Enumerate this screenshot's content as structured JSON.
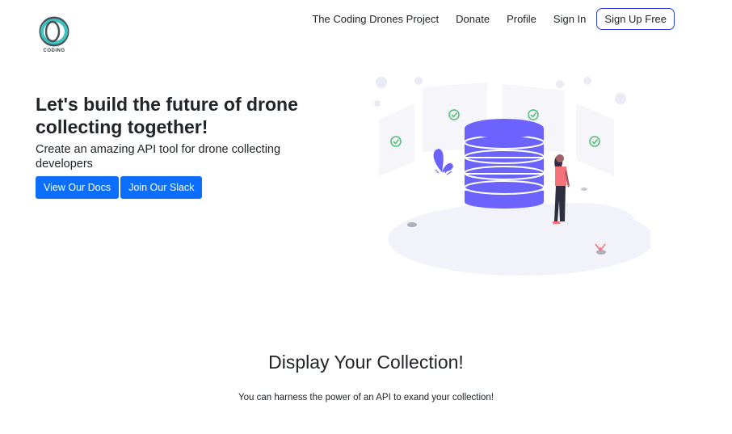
{
  "brand": {
    "logo_text": "CODING"
  },
  "nav": {
    "links": [
      "The Coding Drones Project",
      "Donate",
      "Profile",
      "Sign In"
    ],
    "signup_label": "Sign Up Free"
  },
  "hero": {
    "title": "Let's build the future of drone collecting together!",
    "subtitle": "Create an amazing API tool for drone collecting developers",
    "buttons": [
      "View Our Docs",
      "Join Our Slack"
    ]
  },
  "section": {
    "title": "Display Your Collection!",
    "subtitle": "You can harness the power of an API to exand your collection!"
  },
  "colors": {
    "primary": "#0d6efd",
    "signup_border": "#2f3fd4",
    "illustration_purple": "#6c63ff",
    "logo_teal": "#3cc1c0"
  }
}
